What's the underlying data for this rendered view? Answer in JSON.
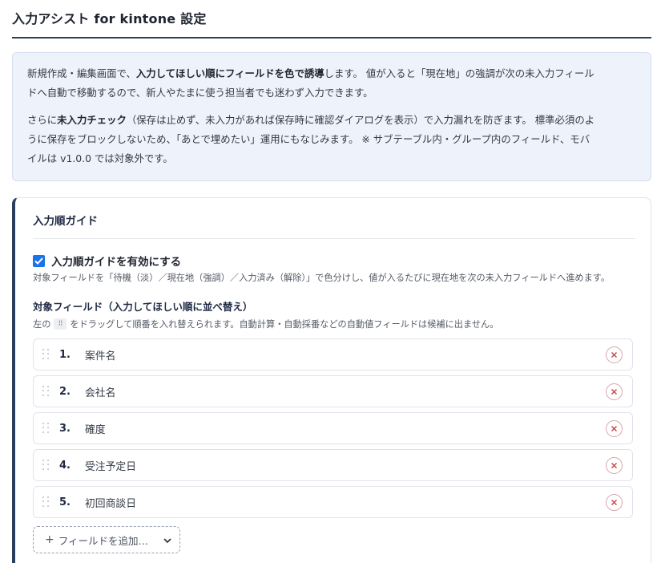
{
  "page": {
    "title": "入力アシスト for kintone 設定"
  },
  "intro": {
    "p1_a": "新規作成・編集画面で、",
    "p1_b": "入力してほしい順にフィールドを色で誘導",
    "p1_c": "します。 値が入ると「現在地」の強調が次の未入力フィール",
    "p1_d": "ドへ自動で移動するので、新人やたまに使う担当者でも迷わず入力できます。",
    "p2_a": "さらに",
    "p2_b": "未入力チェック",
    "p2_c": "（保存は止めず、未入力があれば保存時に確認ダイアログを表示）で入力漏れを防ぎます。 標準必須のよ",
    "p2_d": "うに保存をブロックしないため、「あとで埋めたい」運用にもなじみます。 ※ サブテーブル内・グループ内のフィールド、モバ",
    "p2_e": "イルは v1.0.0 では対象外です。"
  },
  "guide": {
    "title": "入力順ガイド",
    "enable_label": "入力順ガイドを有効にする",
    "enable_checked": true,
    "enable_help": "対象フィールドを「待機（淡）／現在地（強調）／入力済み（解除）」で色分けし、値が入るたびに現在地を次の未入力フィールドへ進めます。",
    "target_label": "対象フィールド（入力してほしい順に並べ替え）",
    "target_help_before": "左の",
    "target_help_handle": "⠿",
    "target_help_after": "をドラッグして順番を入れ替えられます。自動計算・自動採番などの自動値フィールドは候補に出ません。",
    "fields": [
      {
        "num": "1.",
        "name": "案件名"
      },
      {
        "num": "2.",
        "name": "会社名"
      },
      {
        "num": "3.",
        "name": "確度"
      },
      {
        "num": "4.",
        "name": "受注予定日"
      },
      {
        "num": "5.",
        "name": "初回商談日"
      }
    ],
    "add_field_label": "フィールドを追加…",
    "add_field_plus": "+"
  },
  "colors": {
    "accent": "#2c3e5e",
    "checkbox": "#1a73e8",
    "intro_bg": "#eef3fb",
    "remove": "#c0504d"
  },
  "icons": {
    "check": "check-icon",
    "drag": "drag-handle-icon",
    "remove": "close-circle-icon",
    "chevron": "chevron-down-icon"
  }
}
